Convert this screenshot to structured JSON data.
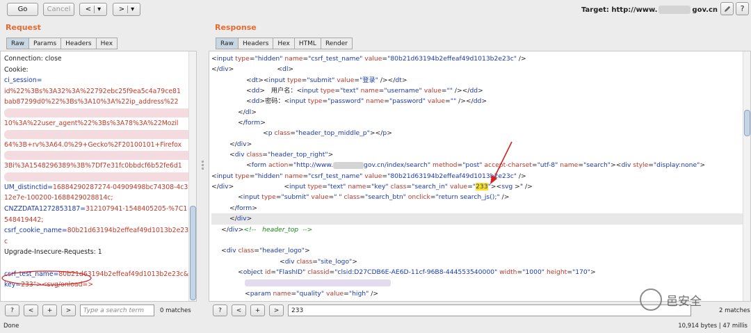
{
  "toolbar": {
    "go_label": "Go",
    "cancel_label": "Cancel",
    "back_label": "<",
    "back_menu_label": "▾",
    "forward_label": ">",
    "forward_menu_label": "▾",
    "target_prefix": "Target: http://www.",
    "target_suffix": "gov.cn",
    "edit_icon": "pencil-icon",
    "help_label": "?"
  },
  "request": {
    "title": "Request",
    "tabs": [
      "Raw",
      "Params",
      "Headers",
      "Hex"
    ],
    "lines": [
      {
        "k": "Connection: close",
        "v": ""
      },
      {
        "k": "Cookie:",
        "v": ""
      },
      {
        "k": "ci_session=",
        "v": ""
      },
      {
        "k": "",
        "v": "id%22%3Bs%3A32%3A%22792ebc25f9ea5c4a79ce81"
      },
      {
        "k": "",
        "v": "bab87299d0%22%3Bs%3A10%3A%22ip_address%22"
      },
      {
        "k": "",
        "v": ""
      },
      {
        "k": "",
        "v": "10%3A%22user_agent%22%3Bs%3A78%3A%22Mozil"
      },
      {
        "k": "",
        "v": ""
      },
      {
        "k": "",
        "v": "64%3B+rv%3A64.0%29+Gecko%2F20100101+Firefox"
      },
      {
        "k": "",
        "v": ""
      },
      {
        "k": "",
        "v": "3Bi%3A1548296389%3B%7Df7e31fc0bbdcf6b52fe6d1"
      },
      {
        "k": "",
        "v": ""
      },
      {
        "k": "UM_distinctid=",
        "v": "16884290287274-04909498bc74308-4c3"
      },
      {
        "k": "",
        "v": "12e7e-100200-1688429028814c;"
      },
      {
        "k": "CNZZDATA1272853187=",
        "v": "312107941-1548405205-%7C1"
      },
      {
        "k": "",
        "v": "548419442;"
      },
      {
        "k": "csrf_cookie_name=",
        "v": "80b21d63194b2effeaf49d1013b2e23"
      },
      {
        "k": "",
        "v": "c"
      },
      {
        "k": "Upgrade-Insecure-Requests: 1",
        "v": ""
      },
      {
        "k": "",
        "v": ""
      },
      {
        "k": "csrf_test_name=",
        "v": "80b21d63194b2effeaf49d1013b2e23c&"
      },
      {
        "k": "key=",
        "v": "233\"><svg/onload=>"
      }
    ],
    "search_placeholder": "Type a search term",
    "matches": "0 matches"
  },
  "response": {
    "title": "Response",
    "tabs": [
      "Raw",
      "Headers",
      "Hex",
      "HTML",
      "Render"
    ],
    "search_value": "233",
    "matches": "2 matches"
  },
  "search_buttons": {
    "help": "?",
    "prev": "<",
    "add": "+",
    "next": ">"
  },
  "status": {
    "left": "Done",
    "right": "10,914 bytes | 47 millis"
  },
  "watermark": "邑安全"
}
